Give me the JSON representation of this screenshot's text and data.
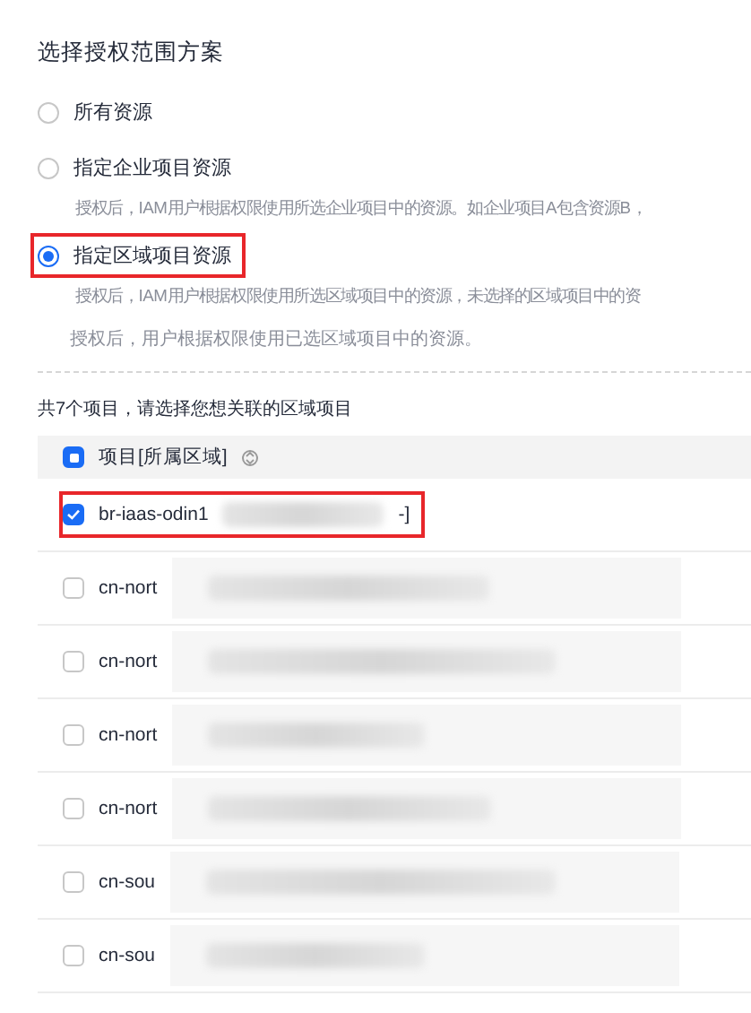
{
  "title": "选择授权范围方案",
  "options": [
    {
      "label": "所有资源",
      "selected": false,
      "highlighted": false
    },
    {
      "label": "指定企业项目资源",
      "selected": false,
      "highlighted": false,
      "description": "授权后，IAM用户根据权限使用所选企业项目中的资源。如企业项目A包含资源B，"
    },
    {
      "label": "指定区域项目资源",
      "selected": true,
      "highlighted": true,
      "description": "授权后，IAM用户根据权限使用所选区域项目中的资源，未选择的区域项目中的资"
    }
  ],
  "note": "授权后，用户根据权限使用已选区域项目中的资源。",
  "count_text": "共7个项目，请选择您想关联的区域项目",
  "table": {
    "header": {
      "label": "项目[所属区域]",
      "indeterminate": true
    },
    "rows": [
      {
        "name": "br-iaas-odin1",
        "tail": "-]",
        "checked": true,
        "highlighted": true
      },
      {
        "name": "cn-nort",
        "checked": false,
        "highlighted": false
      },
      {
        "name": "cn-nort",
        "checked": false,
        "highlighted": false
      },
      {
        "name": "cn-nort",
        "checked": false,
        "highlighted": false
      },
      {
        "name": "cn-nort",
        "checked": false,
        "highlighted": false
      },
      {
        "name": "cn-sou",
        "checked": false,
        "highlighted": false
      },
      {
        "name": "cn-sou",
        "checked": false,
        "highlighted": false
      }
    ]
  }
}
